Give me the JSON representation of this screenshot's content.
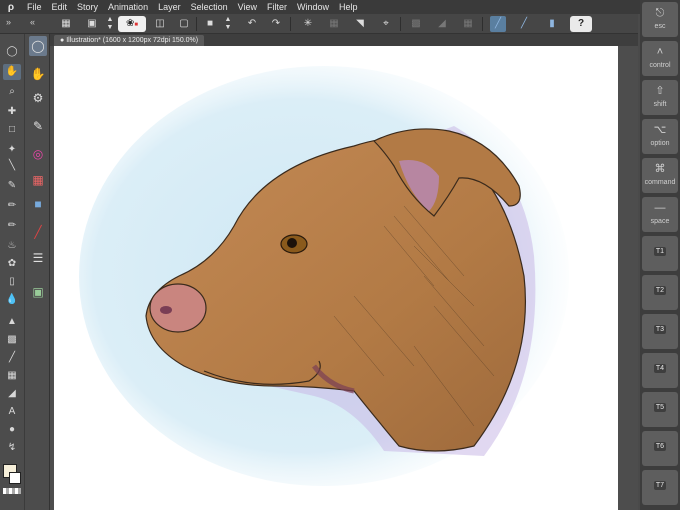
{
  "menubar": {
    "logo": "ρ",
    "items": [
      "File",
      "Edit",
      "Story",
      "Animation",
      "Layer",
      "Selection",
      "View",
      "Filter",
      "Window",
      "Help"
    ]
  },
  "toolbar": {
    "icons": [
      "grid-icon",
      "fit-icon",
      "stepper-icon",
      "lasso-icon",
      "new-icon",
      "open-icon",
      "save-icon",
      "stepper-icon",
      "undo-icon",
      "redo-icon",
      "loading-icon",
      "transform-icon",
      "clear-icon",
      "crop-icon",
      "fill-icon",
      "select-icon",
      "rule-icon",
      "ruler-snap-icon",
      "pen-snap-icon",
      "brush-snap-icon",
      "help-icon"
    ]
  },
  "document": {
    "tab_label": "Illustration* (1600 x 1200px 72dpi 150.0%)"
  },
  "modifier_keys": [
    {
      "icon": "⎋",
      "label": "esc"
    },
    {
      "icon": "˄",
      "label": "control"
    },
    {
      "icon": "⇧",
      "label": "shift"
    },
    {
      "icon": "⌥",
      "label": "option"
    },
    {
      "icon": "⌘",
      "label": "command"
    },
    {
      "icon": "—",
      "label": "space"
    }
  ],
  "t_keys": [
    "T1",
    "T2",
    "T3",
    "T4",
    "T5",
    "T6",
    "T7"
  ],
  "colors": {
    "accent": "#5a7fa0",
    "main_color": "#f6efd9",
    "sub_color": "#ffffff"
  }
}
